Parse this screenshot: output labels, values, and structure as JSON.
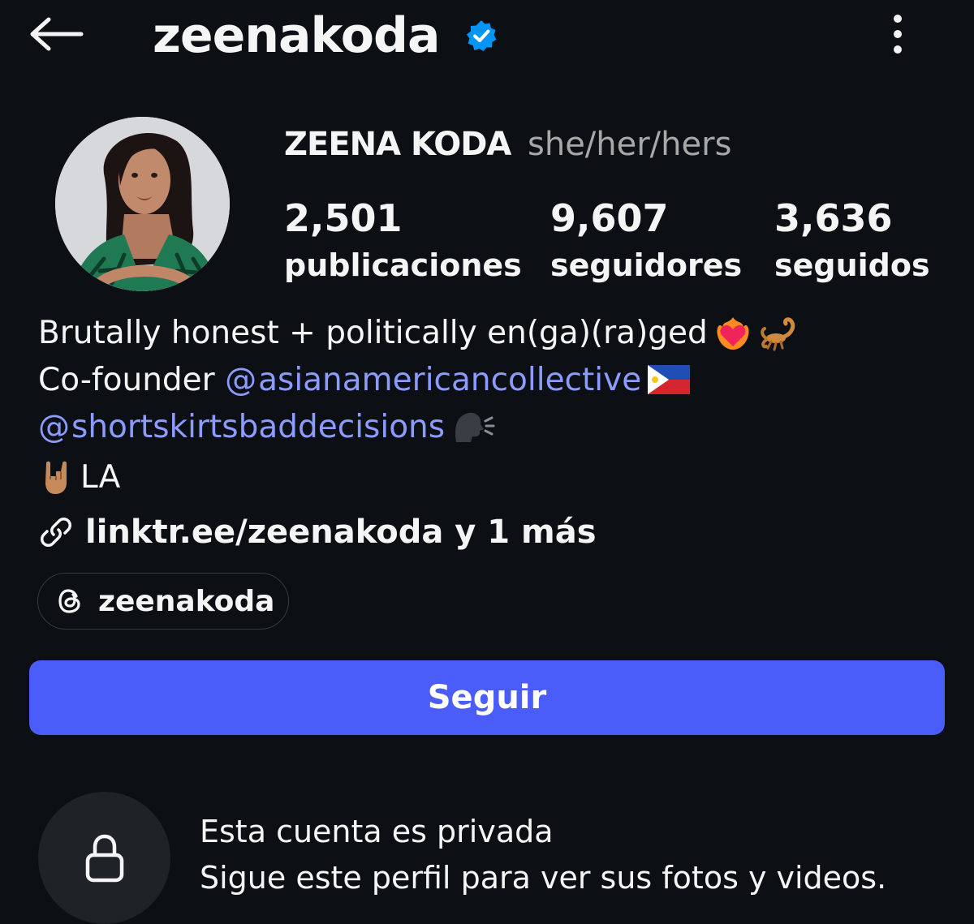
{
  "header": {
    "username": "zeenakoda",
    "back_icon": "arrow-left-icon",
    "verified_icon": "verified-badge-icon",
    "more_icon": "more-vertical-icon"
  },
  "profile": {
    "display_name": "ZEENA KODA",
    "pronouns": "she/her/hers",
    "avatar": "profile-photo"
  },
  "stats": [
    {
      "value": "2,501",
      "label": "publicaciones"
    },
    {
      "value": "9,607",
      "label": "seguidores"
    },
    {
      "value": "3,636",
      "label": "seguidos"
    }
  ],
  "bio": {
    "line1": "Brutally honest + politically en(ga)(ra)ged",
    "line1_emojis": [
      "heart-on-fire",
      "scorpion"
    ],
    "line2_prefix": "Co-founder ",
    "line2_mention": "asianamericancollective",
    "line2_emoji": "philippines-flag",
    "line3_mention": "shortskirtsbaddecisions",
    "line3_emoji": "speaking-head",
    "line4_emoji": "sign-of-the-horns",
    "line4_text": "LA"
  },
  "link": {
    "icon": "link-icon",
    "text": "linktr.ee/zeenakoda y 1 más"
  },
  "threads": {
    "icon": "threads-icon",
    "label": "zeenakoda"
  },
  "follow_button": {
    "label": "Seguir"
  },
  "private": {
    "icon": "lock-icon",
    "title": "Esta cuenta es privada",
    "subtitle": "Sigue este perfil para ver sus fotos y videos."
  },
  "colors": {
    "background": "#0c1014",
    "text": "#f5f5f5",
    "muted": "#a8a8a8",
    "mention": "#8c9bff",
    "follow_button": "#4a5df9",
    "verified": "#0095f6"
  }
}
